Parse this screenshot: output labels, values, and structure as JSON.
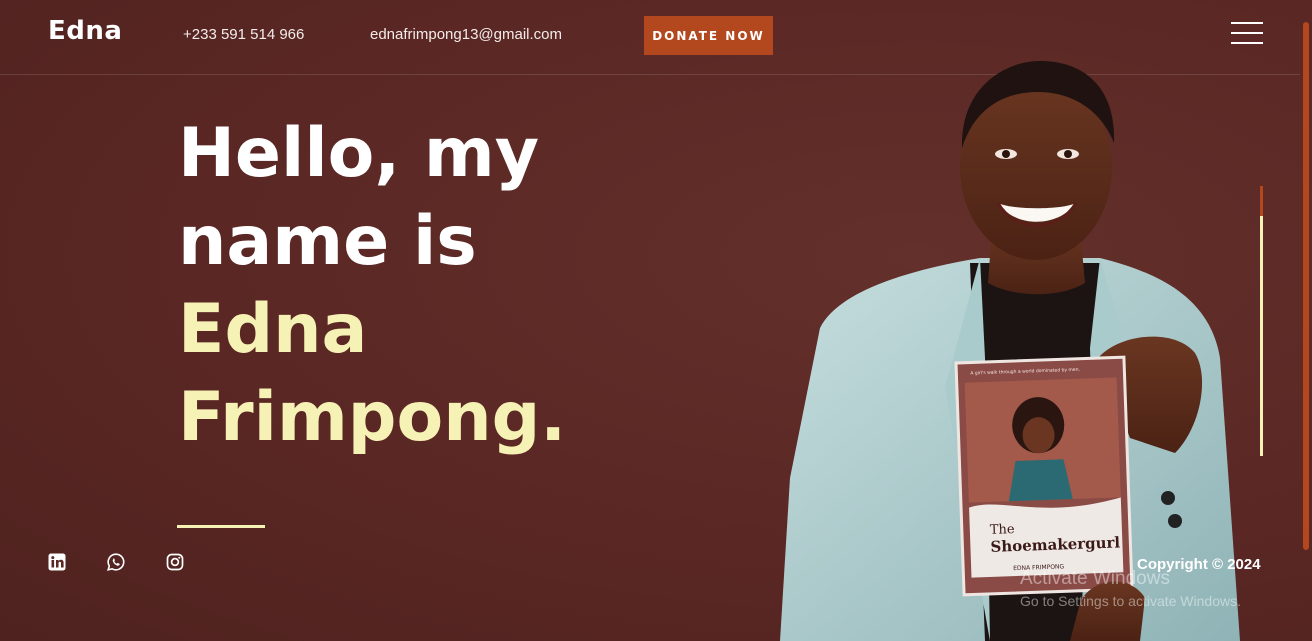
{
  "header": {
    "logo": "Edna",
    "phone": "+233 591 514 966",
    "email": "ednafrimpong13@gmail.com",
    "donate_label": "DONATE NOW",
    "menu_icon": "hamburger-menu-icon"
  },
  "hero": {
    "line1": "Hello, my",
    "line2": "name is",
    "line3": "Edna",
    "line4": "Frimpong."
  },
  "socials": [
    {
      "name": "linkedin",
      "icon": "linkedin-icon"
    },
    {
      "name": "whatsapp",
      "icon": "whatsapp-icon"
    },
    {
      "name": "instagram",
      "icon": "instagram-icon"
    }
  ],
  "book": {
    "tagline": "A girl's walk through a world dominated by men.",
    "title_line1": "The",
    "title_line2": "Shoemakergurl",
    "author": "EDNA FRIMPONG"
  },
  "footer": {
    "copyright": "Copyright © 2024"
  },
  "watermark": {
    "title": "Activate Windows",
    "subtitle": "Go to Settings to activate Windows."
  },
  "colors": {
    "background": "#5a2724",
    "accent": "#b3471e",
    "highlight": "#f6f1b5"
  }
}
